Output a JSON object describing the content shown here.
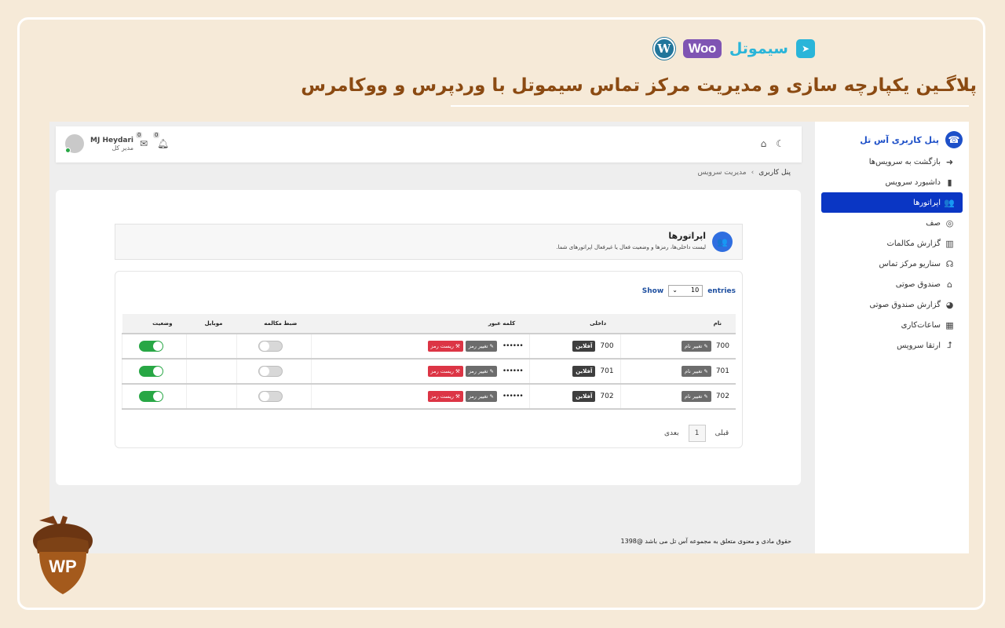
{
  "brand": {
    "simotel_name": "سیموتل",
    "woo_label": "Woo",
    "wp_letter": "W",
    "headline": "پلاگـین یکپارچه سازی و مدیریت مرکز تماس سیموتل با وردپرس و ووکامرس"
  },
  "sidebar": {
    "title": "پنل کاربری آس تل",
    "items": [
      {
        "label": "بازگشت به سرویس‌ها",
        "icon": "arrow-right-icon"
      },
      {
        "label": "داشبورد سرویس",
        "icon": "clipboard-icon"
      },
      {
        "label": "اپراتورها",
        "icon": "users-icon",
        "active": true
      },
      {
        "label": "صف",
        "icon": "queue-icon"
      },
      {
        "label": "گزارش مکالمات",
        "icon": "bar-chart-icon"
      },
      {
        "label": "سناریو مرکز تماس",
        "icon": "headset-icon"
      },
      {
        "label": "صندوق صوتی",
        "icon": "inbox-icon"
      },
      {
        "label": "گزارش صندوق صوتی",
        "icon": "pie-chart-icon"
      },
      {
        "label": "ساعات‌کاری",
        "icon": "calendar-icon"
      },
      {
        "label": "ارتقا سرویس",
        "icon": "upgrade-arrow-icon"
      }
    ]
  },
  "topbar": {
    "user_name": "MJ Heydari",
    "user_role": "مدیر کل",
    "messages_count": "0",
    "notifications_count": "0"
  },
  "breadcrumb": {
    "root": "پنل کاربری",
    "separator": "›",
    "current": "مدیریت سرویس"
  },
  "page": {
    "title": "اپراتورها",
    "subtitle": "لیست داخلی‌ها، رمزها و وضعیت فعال یا غیرفعال اپراتورهای شما."
  },
  "table": {
    "show_label": "Show",
    "entries_label": "entries",
    "page_size": "10",
    "columns": [
      "نام",
      "داخلی",
      "کلمه عبور",
      "ضبط مکالمه",
      "موبایل",
      "وضعیت"
    ],
    "rename_label": "تغییر نام",
    "online_label": "آفلاین",
    "change_pass_label": "تغییر رمز",
    "reset_pass_label": "ریست رمز",
    "rows": [
      {
        "name": "700",
        "ext": "700",
        "password": "••••••",
        "recording": false,
        "mobile": "",
        "status": true
      },
      {
        "name": "701",
        "ext": "701",
        "password": "••••••",
        "recording": false,
        "mobile": "",
        "status": true
      },
      {
        "name": "702",
        "ext": "702",
        "password": "••••••",
        "recording": false,
        "mobile": "",
        "status": true
      }
    ],
    "pager": {
      "prev": "قبلی",
      "current": "1",
      "next": "بعدی"
    }
  },
  "footer": {
    "text": "حقوق مادی و معنوی متعلق به مجموعه آس تل می باشد @1398"
  },
  "watermark": {
    "letters": "WP"
  },
  "colors": {
    "background": "#f6ead8",
    "headline": "#8b4a12",
    "sidebar_active": "#0a36c4",
    "toggle_on": "#28a745",
    "reset_button": "#dc3545"
  }
}
